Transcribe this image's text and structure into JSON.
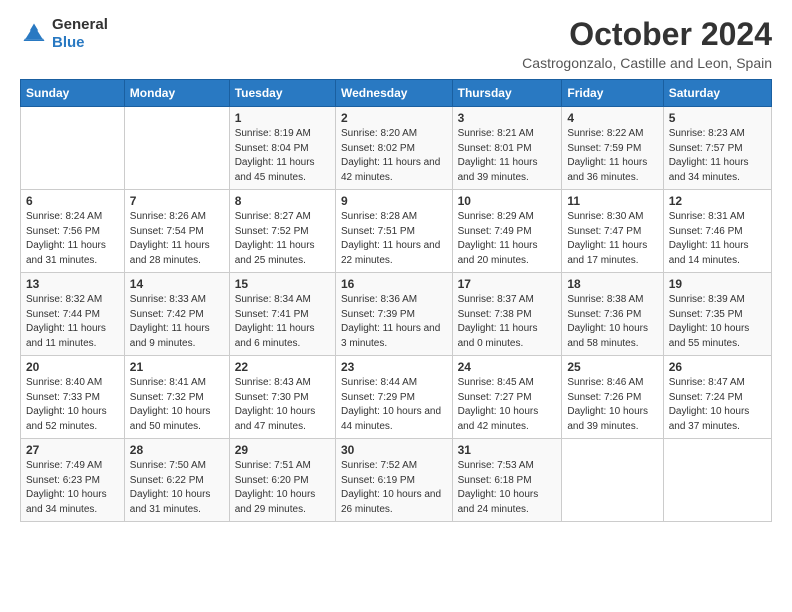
{
  "logo": {
    "line1": "General",
    "line2": "Blue"
  },
  "title": "October 2024",
  "subtitle": "Castrogonzalo, Castille and Leon, Spain",
  "days_of_week": [
    "Sunday",
    "Monday",
    "Tuesday",
    "Wednesday",
    "Thursday",
    "Friday",
    "Saturday"
  ],
  "weeks": [
    [
      {
        "day": "",
        "text": ""
      },
      {
        "day": "",
        "text": ""
      },
      {
        "day": "1",
        "text": "Sunrise: 8:19 AM\nSunset: 8:04 PM\nDaylight: 11 hours and 45 minutes."
      },
      {
        "day": "2",
        "text": "Sunrise: 8:20 AM\nSunset: 8:02 PM\nDaylight: 11 hours and 42 minutes."
      },
      {
        "day": "3",
        "text": "Sunrise: 8:21 AM\nSunset: 8:01 PM\nDaylight: 11 hours and 39 minutes."
      },
      {
        "day": "4",
        "text": "Sunrise: 8:22 AM\nSunset: 7:59 PM\nDaylight: 11 hours and 36 minutes."
      },
      {
        "day": "5",
        "text": "Sunrise: 8:23 AM\nSunset: 7:57 PM\nDaylight: 11 hours and 34 minutes."
      }
    ],
    [
      {
        "day": "6",
        "text": "Sunrise: 8:24 AM\nSunset: 7:56 PM\nDaylight: 11 hours and 31 minutes."
      },
      {
        "day": "7",
        "text": "Sunrise: 8:26 AM\nSunset: 7:54 PM\nDaylight: 11 hours and 28 minutes."
      },
      {
        "day": "8",
        "text": "Sunrise: 8:27 AM\nSunset: 7:52 PM\nDaylight: 11 hours and 25 minutes."
      },
      {
        "day": "9",
        "text": "Sunrise: 8:28 AM\nSunset: 7:51 PM\nDaylight: 11 hours and 22 minutes."
      },
      {
        "day": "10",
        "text": "Sunrise: 8:29 AM\nSunset: 7:49 PM\nDaylight: 11 hours and 20 minutes."
      },
      {
        "day": "11",
        "text": "Sunrise: 8:30 AM\nSunset: 7:47 PM\nDaylight: 11 hours and 17 minutes."
      },
      {
        "day": "12",
        "text": "Sunrise: 8:31 AM\nSunset: 7:46 PM\nDaylight: 11 hours and 14 minutes."
      }
    ],
    [
      {
        "day": "13",
        "text": "Sunrise: 8:32 AM\nSunset: 7:44 PM\nDaylight: 11 hours and 11 minutes."
      },
      {
        "day": "14",
        "text": "Sunrise: 8:33 AM\nSunset: 7:42 PM\nDaylight: 11 hours and 9 minutes."
      },
      {
        "day": "15",
        "text": "Sunrise: 8:34 AM\nSunset: 7:41 PM\nDaylight: 11 hours and 6 minutes."
      },
      {
        "day": "16",
        "text": "Sunrise: 8:36 AM\nSunset: 7:39 PM\nDaylight: 11 hours and 3 minutes."
      },
      {
        "day": "17",
        "text": "Sunrise: 8:37 AM\nSunset: 7:38 PM\nDaylight: 11 hours and 0 minutes."
      },
      {
        "day": "18",
        "text": "Sunrise: 8:38 AM\nSunset: 7:36 PM\nDaylight: 10 hours and 58 minutes."
      },
      {
        "day": "19",
        "text": "Sunrise: 8:39 AM\nSunset: 7:35 PM\nDaylight: 10 hours and 55 minutes."
      }
    ],
    [
      {
        "day": "20",
        "text": "Sunrise: 8:40 AM\nSunset: 7:33 PM\nDaylight: 10 hours and 52 minutes."
      },
      {
        "day": "21",
        "text": "Sunrise: 8:41 AM\nSunset: 7:32 PM\nDaylight: 10 hours and 50 minutes."
      },
      {
        "day": "22",
        "text": "Sunrise: 8:43 AM\nSunset: 7:30 PM\nDaylight: 10 hours and 47 minutes."
      },
      {
        "day": "23",
        "text": "Sunrise: 8:44 AM\nSunset: 7:29 PM\nDaylight: 10 hours and 44 minutes."
      },
      {
        "day": "24",
        "text": "Sunrise: 8:45 AM\nSunset: 7:27 PM\nDaylight: 10 hours and 42 minutes."
      },
      {
        "day": "25",
        "text": "Sunrise: 8:46 AM\nSunset: 7:26 PM\nDaylight: 10 hours and 39 minutes."
      },
      {
        "day": "26",
        "text": "Sunrise: 8:47 AM\nSunset: 7:24 PM\nDaylight: 10 hours and 37 minutes."
      }
    ],
    [
      {
        "day": "27",
        "text": "Sunrise: 7:49 AM\nSunset: 6:23 PM\nDaylight: 10 hours and 34 minutes."
      },
      {
        "day": "28",
        "text": "Sunrise: 7:50 AM\nSunset: 6:22 PM\nDaylight: 10 hours and 31 minutes."
      },
      {
        "day": "29",
        "text": "Sunrise: 7:51 AM\nSunset: 6:20 PM\nDaylight: 10 hours and 29 minutes."
      },
      {
        "day": "30",
        "text": "Sunrise: 7:52 AM\nSunset: 6:19 PM\nDaylight: 10 hours and 26 minutes."
      },
      {
        "day": "31",
        "text": "Sunrise: 7:53 AM\nSunset: 6:18 PM\nDaylight: 10 hours and 24 minutes."
      },
      {
        "day": "",
        "text": ""
      },
      {
        "day": "",
        "text": ""
      }
    ]
  ]
}
